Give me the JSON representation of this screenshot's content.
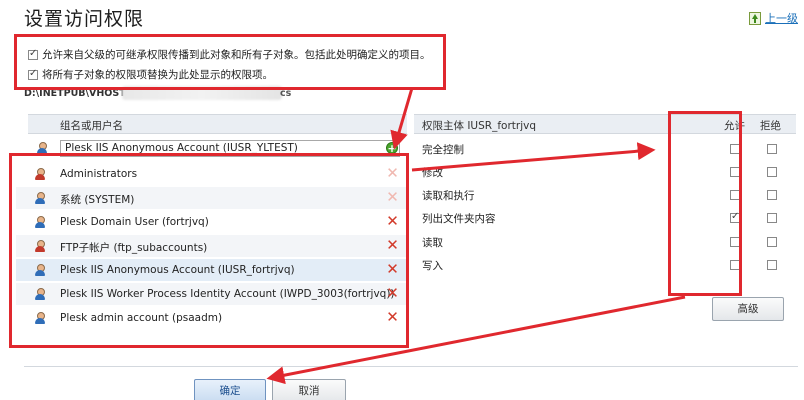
{
  "page": {
    "title": "设置访问权限",
    "up_link_label": "上一级"
  },
  "options": [
    {
      "label": "允许来自父级的可继承权限传播到此对象和所有子对象。包括此处明确定义的项目。",
      "checked": true
    },
    {
      "label": "将所有子对象的权限项替换为此处显示的权限项。",
      "checked": true
    }
  ],
  "path": {
    "prefix": "D:\\INETPUB\\VHOSTS",
    "suffix": "cs"
  },
  "left_panel": {
    "header": "组名或用户名",
    "dropdown_value": "Plesk IIS Anonymous Account (IUSR_YLTEST)",
    "users": [
      {
        "name": "Administrators",
        "icon": "group-icon",
        "removable": false
      },
      {
        "name": "系统 (SYSTEM)",
        "icon": "user-icon",
        "removable": false
      },
      {
        "name": "Plesk Domain User (fortrjvq)",
        "icon": "user-icon",
        "removable": true
      },
      {
        "name": "FTP子帐户 (ftp_subaccounts)",
        "icon": "group-icon",
        "removable": true
      },
      {
        "name": "Plesk IIS Anonymous Account (IUSR_fortrjvq)",
        "icon": "user-icon",
        "removable": true,
        "selected": true
      },
      {
        "name": "Plesk IIS Worker Process Identity Account (IWPD_3003(fortrjvq))",
        "icon": "user-icon",
        "removable": true
      },
      {
        "name": "Plesk admin account (psaadm)",
        "icon": "user-icon",
        "removable": true
      }
    ]
  },
  "right_panel": {
    "principal_label": "权限主体 IUSR_fortrjvq",
    "allow_label": "允许",
    "deny_label": "拒绝",
    "permissions": [
      {
        "label": "完全控制",
        "allow": false,
        "deny": false
      },
      {
        "label": "修改",
        "allow": false,
        "deny": false
      },
      {
        "label": "读取和执行",
        "allow": false,
        "deny": false
      },
      {
        "label": "列出文件夹内容",
        "allow": true,
        "deny": false
      },
      {
        "label": "读取",
        "allow": false,
        "deny": false
      },
      {
        "label": "写入",
        "allow": false,
        "deny": false
      }
    ],
    "advanced_label": "高级"
  },
  "footer": {
    "ok_label": "确定",
    "cancel_label": "取消"
  },
  "colors": {
    "annotation_red": "#e0282e",
    "link_blue": "#1a6fb9",
    "header_bg": "#eaeef3"
  }
}
